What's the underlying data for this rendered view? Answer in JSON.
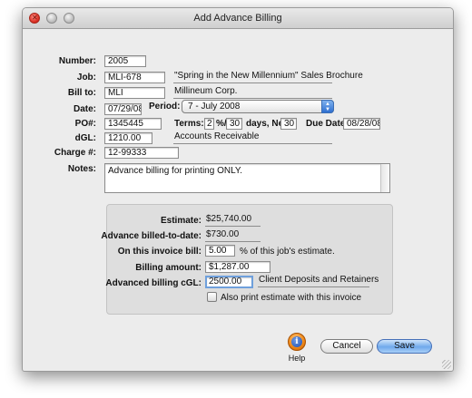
{
  "window": {
    "title": "Add Advance Billing"
  },
  "form": {
    "number_label": "Number:",
    "number": "2005",
    "job_label": "Job:",
    "job": "MLI-678",
    "job_desc": "\"Spring in the New Millennium\" Sales Brochure",
    "billto_label": "Bill to:",
    "billto": "MLI",
    "billto_desc": "Millineum Corp.",
    "date_label": "Date:",
    "date": "07/29/08",
    "period_label": "Period:",
    "period": "7 - July 2008",
    "po_label": "PO#:",
    "po": "1345445",
    "terms_label": "Terms:",
    "terms_pct": "2",
    "terms_pct_sym": "%/",
    "terms_days": "30",
    "terms_days_label": "days, Net:",
    "terms_net": "30",
    "duedate_label": "Due Date:",
    "duedate": "08/28/08",
    "dgl_label": "dGL:",
    "dgl": "1210.00",
    "dgl_desc": "Accounts Receivable",
    "charge_label": "Charge #:",
    "charge": "12-99333",
    "notes_label": "Notes:",
    "notes": "Advance billing for printing ONLY."
  },
  "billing": {
    "estimate_label": "Estimate:",
    "estimate": "$25,740.00",
    "advance_label": "Advance billed-to-date:",
    "advance": "$730.00",
    "oninvoice_label": "On this invoice bill:",
    "oninvoice": "5.00",
    "oninvoice_suffix": "% of this job's estimate.",
    "amount_label": "Billing amount:",
    "amount": "$1,287.00",
    "cgl_label": "Advanced billing cGL:",
    "cgl": "2500.00",
    "cgl_desc": "Client Deposits and Retainers",
    "print_estimate_label": "Also print estimate with this invoice",
    "print_estimate_checked": false
  },
  "buttons": {
    "help": "Help",
    "cancel": "Cancel",
    "save": "Save"
  },
  "colors": {
    "accent": "#6fa9ec",
    "close": "#d7261b",
    "help": "#f08a1a"
  }
}
